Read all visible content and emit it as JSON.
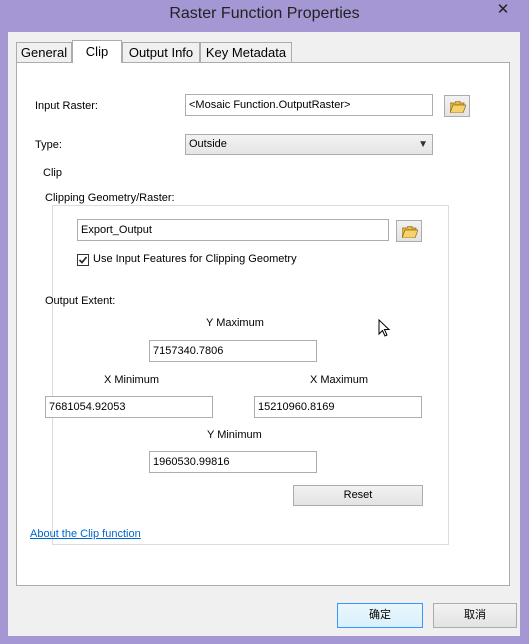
{
  "window": {
    "title": "Raster Function Properties",
    "close_glyph": "✕"
  },
  "tabs": [
    "General",
    "Clip",
    "Output Info",
    "Key Metadata"
  ],
  "input_raster": {
    "label": "Input Raster:",
    "value": "<Mosaic Function.OutputRaster>"
  },
  "type": {
    "label": "Type:",
    "value": "Outside"
  },
  "clip_group": {
    "title": "Clip",
    "geometry_label": "Clipping Geometry/Raster:",
    "geometry_value": "Export_Output",
    "use_input_features": {
      "label": "Use Input Features for Clipping Geometry",
      "checked": true
    },
    "output_extent_label": "Output Extent:",
    "ymax": {
      "label": "Y Maximum",
      "value": "7157340.7806"
    },
    "xmin": {
      "label": "X Minimum",
      "value": "7681054.92053"
    },
    "xmax": {
      "label": "X Maximum",
      "value": "15210960.8169"
    },
    "ymin": {
      "label": "Y Minimum",
      "value": "1960530.99816"
    },
    "reset_label": "Reset"
  },
  "about_link": "About the Clip function",
  "ok_label": "确定",
  "cancel_label": "取消"
}
